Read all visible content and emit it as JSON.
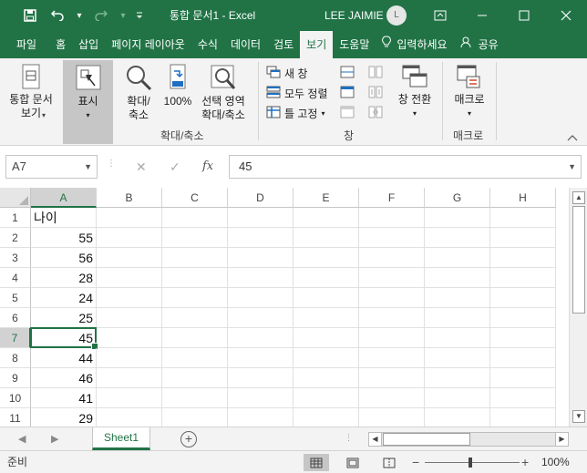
{
  "titlebar": {
    "doc_title": "통합 문서1  -  Excel",
    "user_name": "LEE JAIMIE",
    "avatar_initial": "L"
  },
  "tabs": [
    {
      "label": "파일"
    },
    {
      "label": "홈"
    },
    {
      "label": "삽입"
    },
    {
      "label": "페이지 레이아웃"
    },
    {
      "label": "수식"
    },
    {
      "label": "데이터"
    },
    {
      "label": "검토"
    },
    {
      "label": "보기"
    },
    {
      "label": "도움말"
    },
    {
      "label": "입력하세요"
    },
    {
      "label": "공유"
    }
  ],
  "ribbon": {
    "workbook_view": "통합 문서\n보기",
    "show": "표시",
    "zoom": "확대/\n축소",
    "zoom100": "100%",
    "zoom_selection": "선택 영역\n확대/축소",
    "zoom_group": "확대/축소",
    "new_window": "새 창",
    "arrange_all": "모두 정렬",
    "freeze_panes": "틀 고정",
    "switch_windows": "창 전환",
    "window_group": "창",
    "macros": "매크로",
    "macros_group": "매크로"
  },
  "formula_bar": {
    "name_box": "A7",
    "value": "45"
  },
  "grid": {
    "columns": [
      "A",
      "B",
      "C",
      "D",
      "E",
      "F",
      "G",
      "H"
    ],
    "active_column": "A",
    "active_row": "7",
    "rows": [
      {
        "num": "1",
        "a": "나이"
      },
      {
        "num": "2",
        "a": "55"
      },
      {
        "num": "3",
        "a": "56"
      },
      {
        "num": "4",
        "a": "28"
      },
      {
        "num": "5",
        "a": "24"
      },
      {
        "num": "6",
        "a": "25"
      },
      {
        "num": "7",
        "a": "45"
      },
      {
        "num": "8",
        "a": "44"
      },
      {
        "num": "9",
        "a": "46"
      },
      {
        "num": "10",
        "a": "41"
      },
      {
        "num": "11",
        "a": "29"
      }
    ]
  },
  "sheet_tabs": {
    "active": "Sheet1",
    "add": "+"
  },
  "status": {
    "ready": "준비",
    "zoom": "100%"
  },
  "colors": {
    "accent": "#217346"
  }
}
